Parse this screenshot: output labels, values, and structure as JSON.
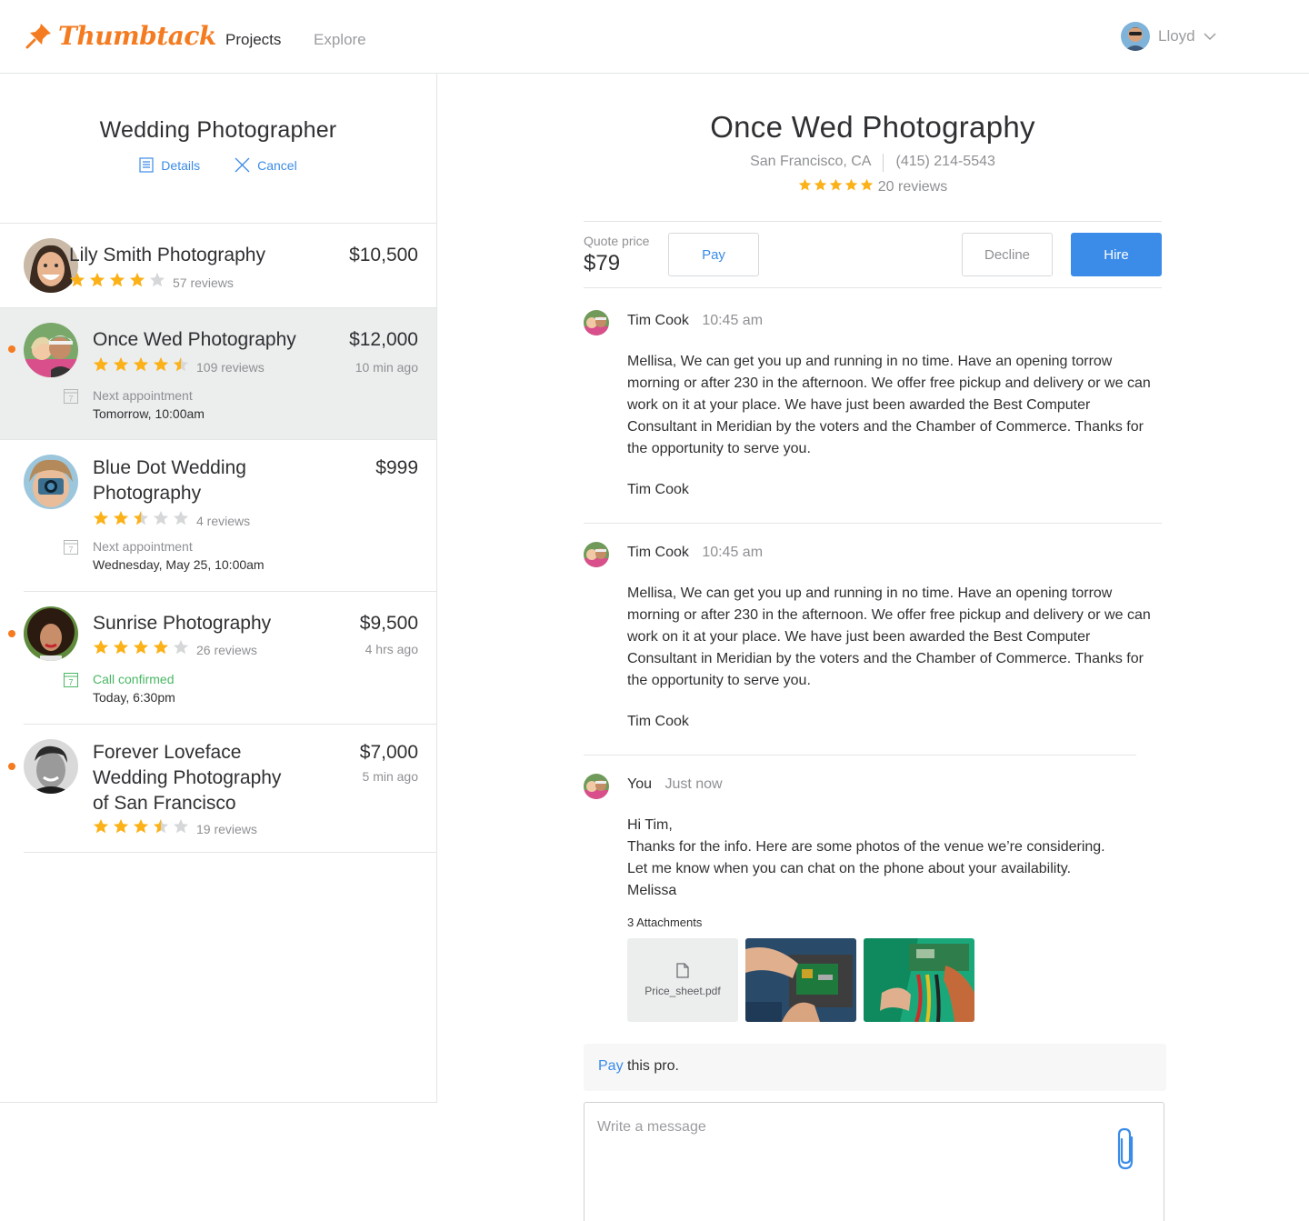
{
  "header": {
    "logo": "Thumbtack",
    "nav": {
      "projects": "Projects",
      "explore": "Explore"
    },
    "user": {
      "name": "Lloyd"
    }
  },
  "project": {
    "title": "Wedding Photographer",
    "details_label": "Details",
    "cancel_label": "Cancel"
  },
  "quotes": [
    {
      "name": "Lily Smith Photography",
      "price": "$10,500",
      "rating": 4,
      "reviews": "57 reviews"
    },
    {
      "name": "Once Wed Photography",
      "price": "$12,000",
      "time": "10 min ago",
      "rating": 4.5,
      "reviews": "109 reviews",
      "appt_label": "Next appointment",
      "appt_value": "Tomorrow, 10:00am"
    },
    {
      "name_line1": "Blue Dot Wedding",
      "name_line2": "Photography",
      "price": "$999",
      "rating": 2.5,
      "reviews": "4 reviews",
      "appt_label": "Next appointment",
      "appt_value": "Wednesday, May 25, 10:00am"
    },
    {
      "name": "Sunrise Photography",
      "price": "$9,500",
      "time": "4 hrs ago",
      "rating": 4,
      "reviews": "26 reviews",
      "appt_label": "Call confirmed",
      "appt_value": "Today, 6:30pm"
    },
    {
      "name_line1": "Forever Loveface",
      "name_line2": "Wedding Photography",
      "name_line3": "of San Francisco",
      "price": "$7,000",
      "time": "5 min ago",
      "rating": 3.5,
      "reviews": "19 reviews"
    }
  ],
  "pro": {
    "name": "Once Wed Photography",
    "location": "San Francisco, CA",
    "phone": "(415) 214-5543",
    "rating": 5,
    "reviews": "20 reviews"
  },
  "quote_bar": {
    "label": "Quote price",
    "price": "$79",
    "pay": "Pay",
    "decline": "Decline",
    "hire": "Hire"
  },
  "messages": [
    {
      "author": "Tim Cook",
      "time": "10:45 am",
      "body": "Mellisa, We can get you up and running in no time. Have an opening torrow morning or after 230 in the afternoon. We offer free pickup and delivery or we can work on it at your place. We have just been awarded the Best Computer Consultant in Meridian by the voters and the Chamber of Commerce. Thanks for the opportunity to serve you.",
      "signature": "Tim Cook"
    },
    {
      "author": "Tim Cook",
      "time": "10:45 am",
      "body": "Mellisa, We can get you up and running in no time. Have an opening torrow morning or after 230 in the afternoon. We offer free pickup and delivery or we can work on it at your place. We have just been awarded the Best Computer Consultant in Meridian by the voters and the Chamber of Commerce. Thanks for the opportunity to serve you.",
      "signature": "Tim Cook"
    },
    {
      "author": "You",
      "time": "Just now",
      "lines": [
        "Hi Tim,",
        "Thanks for the info. Here are some photos of the venue we’re considering.",
        "Let me know when you can chat on the phone about your availability.",
        "Melissa"
      ]
    }
  ],
  "attachments": {
    "label": "3 Attachments",
    "file_name": "Price_sheet.pdf"
  },
  "pay_banner": {
    "link": "Pay",
    "text": " this pro."
  },
  "composer": {
    "placeholder": "Write a message"
  },
  "colors": {
    "brand": "#f47b20",
    "accent": "#3b8be8",
    "star": "#fbb117",
    "unread": "#f47b20",
    "confirmed": "#4ab763"
  }
}
